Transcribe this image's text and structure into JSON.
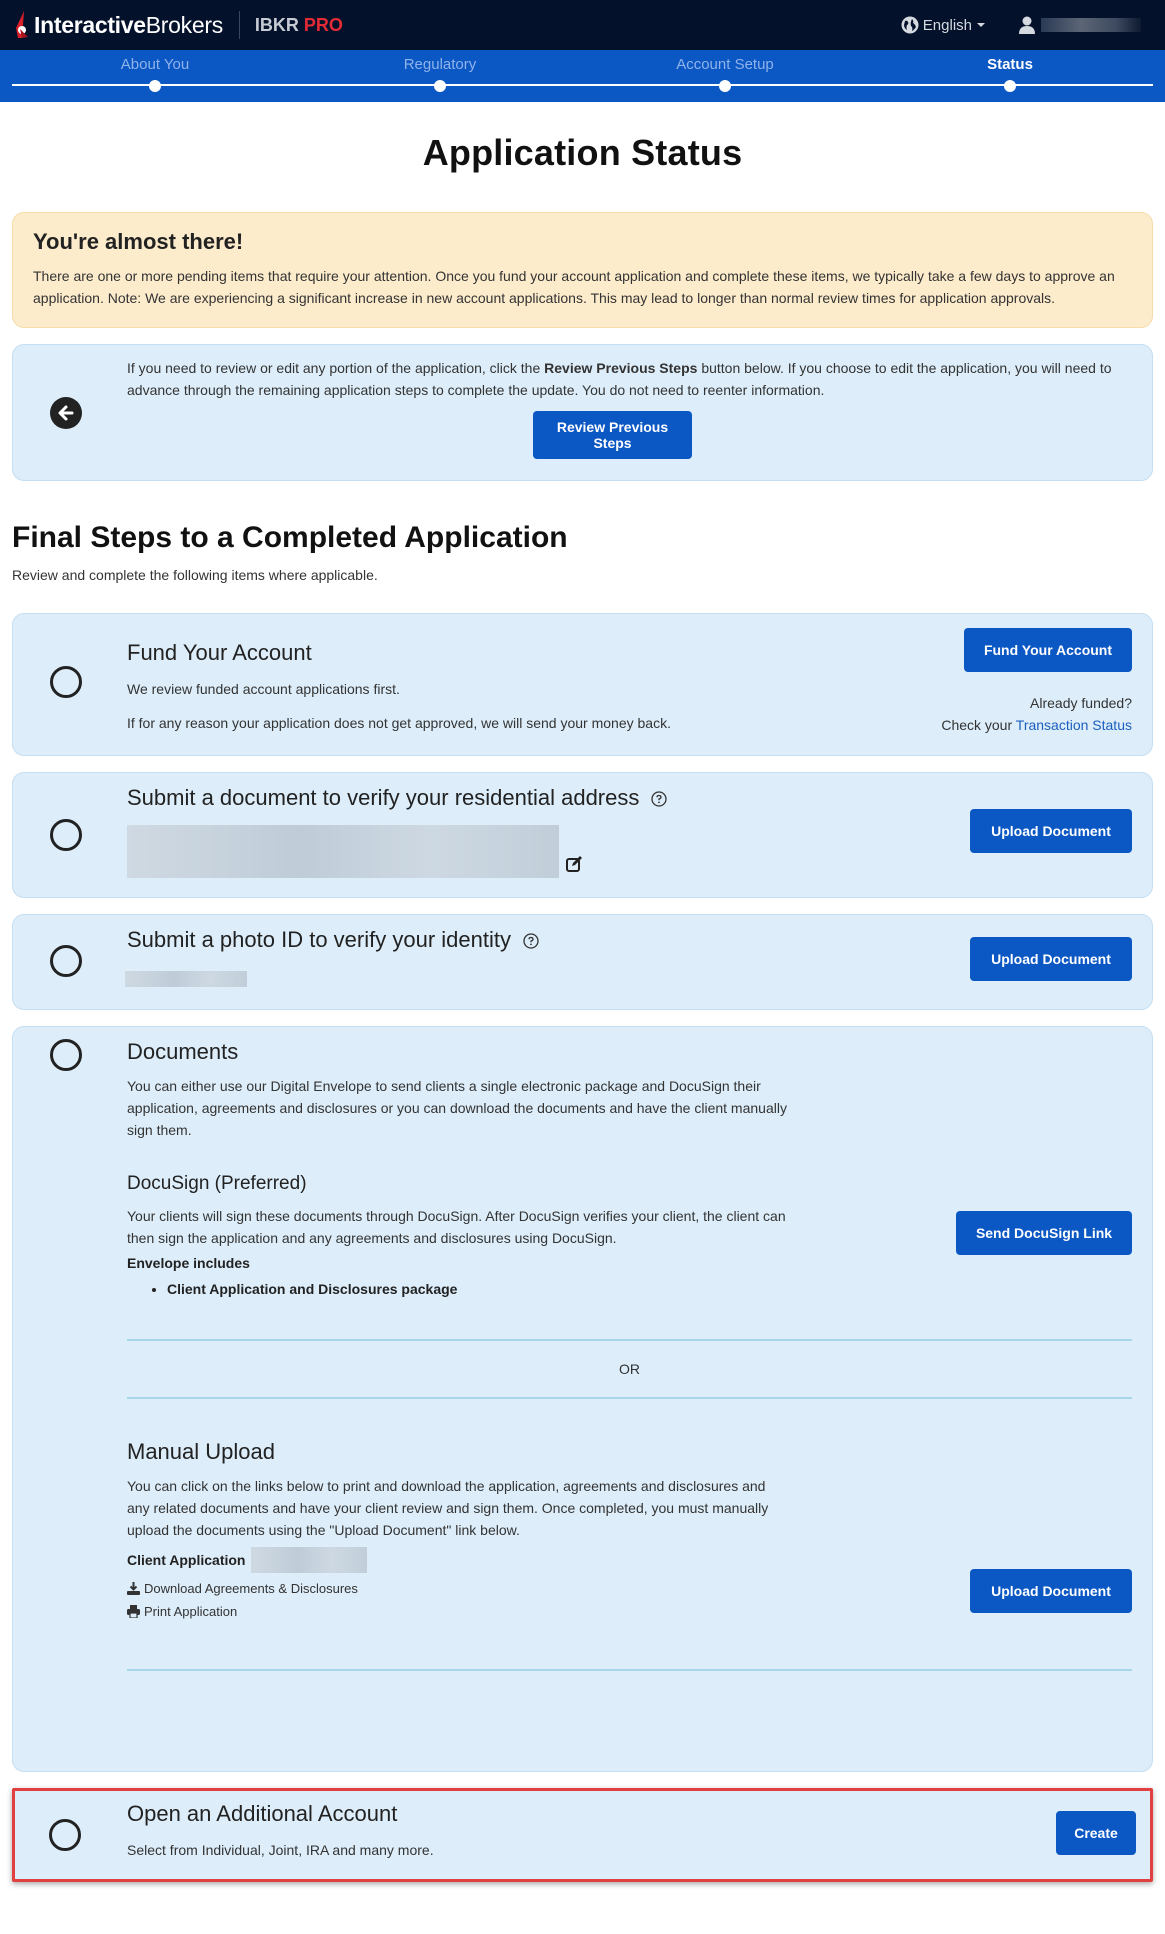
{
  "header": {
    "brand_bold": "Interactive",
    "brand_light": "Brokers",
    "product": "IBKR",
    "product_accent": "PRO",
    "language": "English",
    "colors": {
      "nav_bg": "#03112b",
      "accent_red": "#e32b36",
      "stepper_bg": "#0b57c4"
    }
  },
  "stepper": {
    "steps": [
      {
        "label": "About You",
        "active": false
      },
      {
        "label": "Regulatory",
        "active": false
      },
      {
        "label": "Account Setup",
        "active": false
      },
      {
        "label": "Status",
        "active": true
      }
    ]
  },
  "page": {
    "title": "Application Status",
    "alert": {
      "heading": "You're almost there!",
      "text": "There are one or more pending items that require your attention. Once you fund your account application and complete these items, we typically take a few days to approve an application. Note: We are experiencing a significant increase in new account applications. This may lead to longer than normal review times for application approvals."
    },
    "review": {
      "text_before": "If you need to review or edit any portion of the application, click the ",
      "text_bold": "Review Previous Steps",
      "text_after": " button below. If you choose to edit the application, you will need to advance through the remaining application steps to complete the update. You do not need to reenter information.",
      "button": "Review Previous Steps"
    },
    "section_title": "Final Steps to a Completed Application",
    "section_subtitle": "Review and complete the following items where applicable.",
    "tasks": {
      "fund": {
        "title": "Fund Your Account",
        "line1": "We review funded account applications first.",
        "line2": "If for any reason your application does not get approved, we will send your money back.",
        "button": "Fund Your Account",
        "already_funded": "Already funded?",
        "check_prefix": "Check your ",
        "check_link": "Transaction Status"
      },
      "address": {
        "title": "Submit a document to verify your residential address",
        "button": "Upload Document"
      },
      "photo_id": {
        "title": "Submit a photo ID to verify your identity",
        "button": "Upload Document"
      },
      "documents": {
        "title": "Documents",
        "desc": "You can either use our Digital Envelope to send clients a single electronic package and DocuSign their application, agreements and disclosures or you can download the documents and have the client manually sign them.",
        "docusign": {
          "title": "DocuSign (Preferred)",
          "desc": "Your clients will sign these documents through DocuSign. After DocuSign verifies your client, the client can then sign the application and any agreements and disclosures using DocuSign.",
          "envelope_title": "Envelope includes",
          "envelope_items": [
            "Client Application and Disclosures package"
          ],
          "button": "Send DocuSign Link"
        },
        "or_label": "OR",
        "manual": {
          "title": "Manual Upload",
          "desc": "You can click on the links below to print and download the application, agreements and disclosures and any related documents and have your client review and sign them. Once completed, you must manually upload the documents using the \"Upload Document\" link below.",
          "client_application_label": "Client Application",
          "download_link": "Download Agreements & Disclosures",
          "print_link": "Print Application",
          "button": "Upload Document"
        }
      },
      "additional": {
        "title": "Open an Additional Account",
        "desc": "Select from Individual, Joint, IRA and many more.",
        "button": "Create"
      }
    }
  }
}
